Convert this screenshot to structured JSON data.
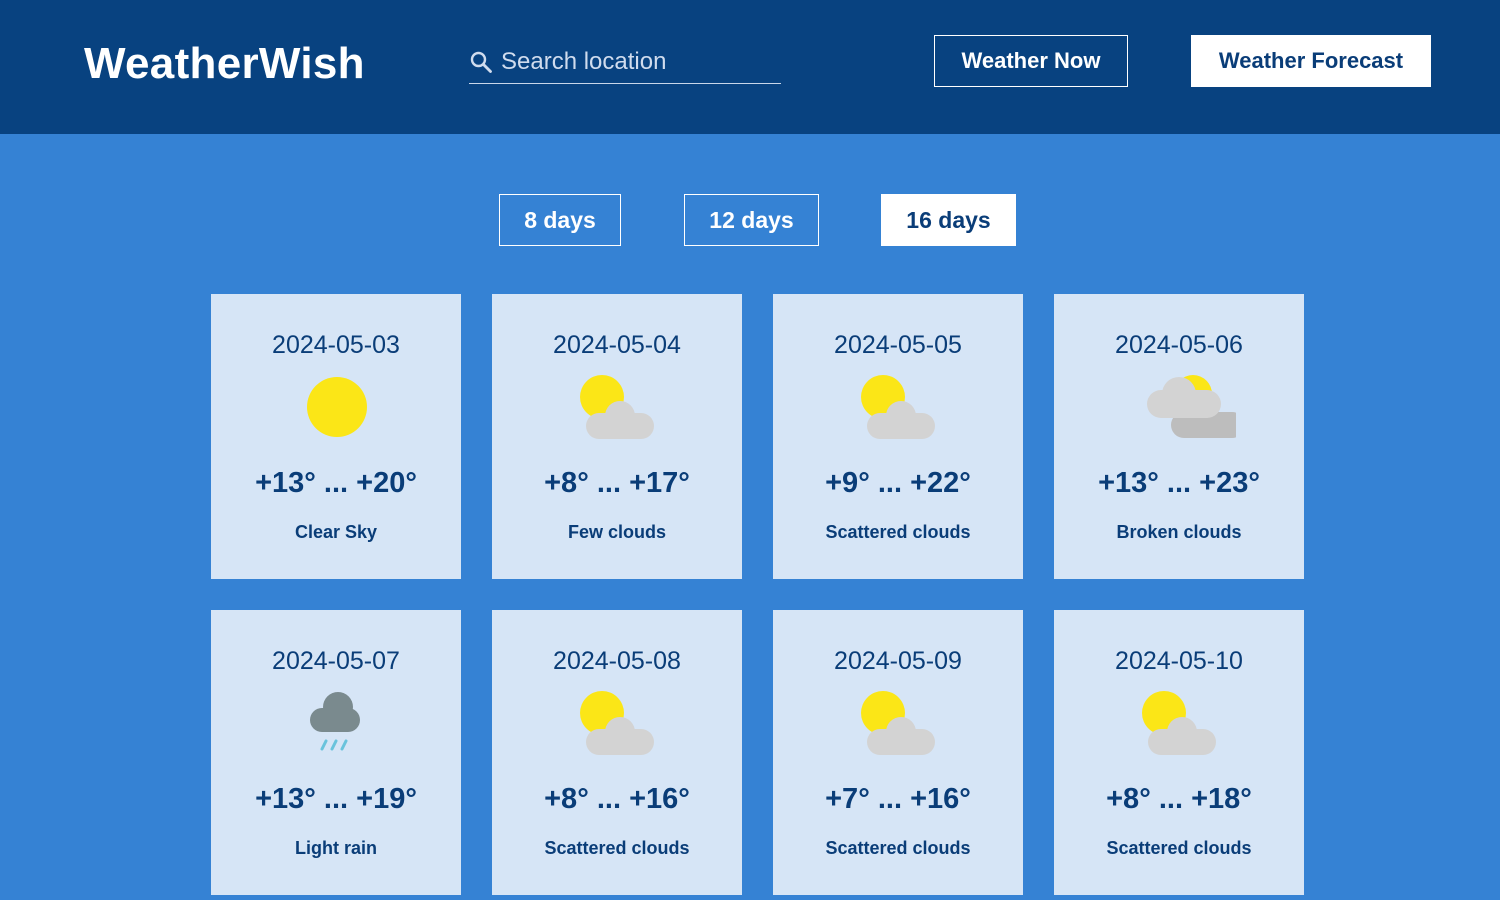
{
  "app": {
    "logo": "WeatherWish"
  },
  "search": {
    "placeholder": "Search location",
    "value": ""
  },
  "nav": {
    "now_label": "Weather Now",
    "forecast_label": "Weather Forecast",
    "active": "Weather Forecast"
  },
  "ranges": {
    "items": [
      {
        "label": "8 days",
        "active": false
      },
      {
        "label": "12 days",
        "active": false
      },
      {
        "label": "16 days",
        "active": true
      }
    ]
  },
  "colors": {
    "header_bg": "#084280",
    "page_bg": "#3582d4",
    "card_bg": "#d6e5f6",
    "text": "#0a3d78",
    "sun": "#fbe617",
    "cloud_light": "#d3d3d3",
    "cloud_dark": "#bdbdbd",
    "rain_cloud": "#7a8a8e",
    "rain": "#6ac3dc"
  },
  "forecast": {
    "days": [
      {
        "date": "2024-05-03",
        "temp": "+13° ... +20°",
        "desc": "Clear Sky",
        "icon": "sun-icon"
      },
      {
        "date": "2024-05-04",
        "temp": "+8° ... +17°",
        "desc": "Few clouds",
        "icon": "sun-cloud-icon"
      },
      {
        "date": "2024-05-05",
        "temp": "+9° ... +22°",
        "desc": "Scattered clouds",
        "icon": "sun-cloud-icon"
      },
      {
        "date": "2024-05-06",
        "temp": "+13° ... +23°",
        "desc": "Broken clouds",
        "icon": "broken-clouds-icon"
      },
      {
        "date": "2024-05-07",
        "temp": "+13° ... +19°",
        "desc": "Light rain",
        "icon": "rain-cloud-icon"
      },
      {
        "date": "2024-05-08",
        "temp": "+8° ... +16°",
        "desc": "Scattered clouds",
        "icon": "sun-cloud-icon"
      },
      {
        "date": "2024-05-09",
        "temp": "+7° ... +16°",
        "desc": "Scattered clouds",
        "icon": "sun-cloud-icon"
      },
      {
        "date": "2024-05-10",
        "temp": "+8° ... +18°",
        "desc": "Scattered clouds",
        "icon": "sun-cloud-icon"
      }
    ]
  }
}
